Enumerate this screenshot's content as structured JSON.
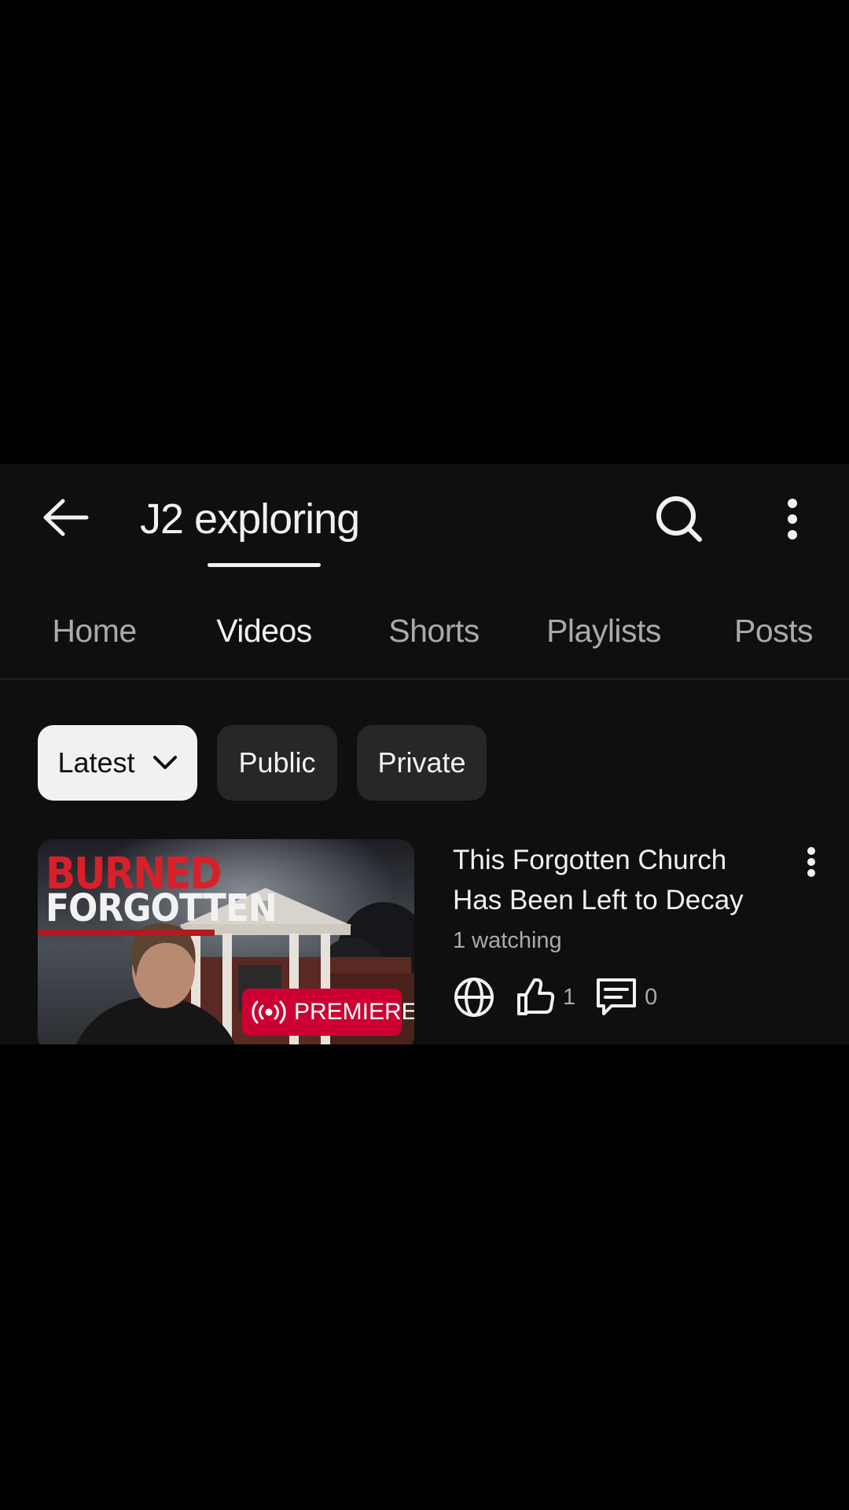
{
  "header": {
    "channel_title": "J2 exploring",
    "back_icon": "arrow-left-icon",
    "search_icon": "search-icon",
    "more_icon": "more-vertical-icon"
  },
  "tabs": [
    {
      "label": "Home",
      "active": false
    },
    {
      "label": "Videos",
      "active": true
    },
    {
      "label": "Shorts",
      "active": false
    },
    {
      "label": "Playlists",
      "active": false
    },
    {
      "label": "Posts",
      "active": false
    }
  ],
  "filters": {
    "sort": {
      "label": "Latest",
      "selected": true,
      "icon": "chevron-down-icon"
    },
    "chips": [
      {
        "label": "Public",
        "selected": false
      },
      {
        "label": "Private",
        "selected": false
      }
    ]
  },
  "videos": [
    {
      "title": "This Forgotten Church Has Been Left to Decay",
      "status": "1 watching",
      "badge": "PREMIERE",
      "thumbnail_text": [
        "BURNED",
        "FORGOTTEN"
      ],
      "visibility_icon": "globe-icon",
      "likes": "1",
      "comments": "0"
    }
  ],
  "colors": {
    "background": "#0f0f0f",
    "premiere_badge": "#cc0033",
    "chip_selected": "#f1f1f1",
    "chip": "#272727"
  }
}
